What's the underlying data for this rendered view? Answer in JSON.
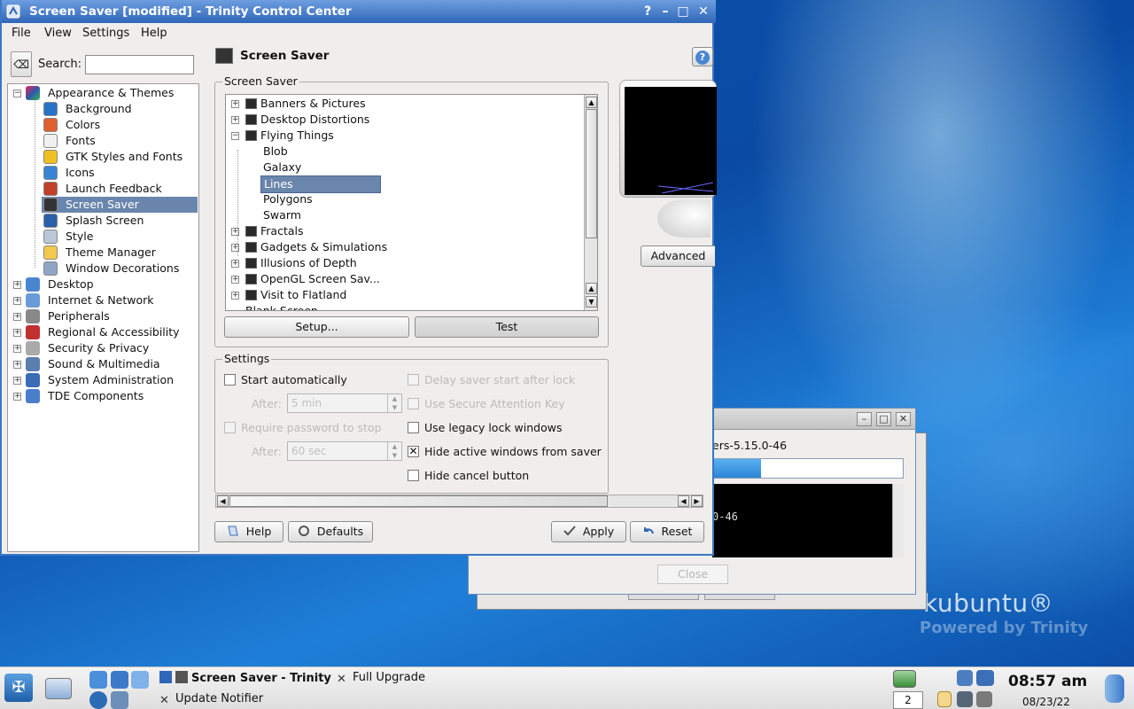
{
  "window": {
    "title": "Screen Saver [modified] - Trinity Control Center",
    "controls": {
      "help": "?",
      "minimize": "–",
      "maximize": "□",
      "close": "✕"
    }
  },
  "menu": [
    "File",
    "View",
    "Settings",
    "Help"
  ],
  "search": {
    "label": "Search:",
    "value": ""
  },
  "sidebar": {
    "appearance": {
      "label": "Appearance & Themes",
      "expander": "⊟"
    },
    "children": [
      {
        "label": "Background",
        "icon": "background-icon"
      },
      {
        "label": "Colors",
        "icon": "colors-icon"
      },
      {
        "label": "Fonts",
        "icon": "fonts-icon"
      },
      {
        "label": "GTK Styles and Fonts",
        "icon": "gtk-icon"
      },
      {
        "label": "Icons",
        "icon": "icons-icon"
      },
      {
        "label": "Launch Feedback",
        "icon": "launch-feedback-icon"
      },
      {
        "label": "Screen Saver",
        "icon": "screen-saver-icon",
        "selected": true
      },
      {
        "label": "Splash Screen",
        "icon": "splash-icon"
      },
      {
        "label": "Style",
        "icon": "style-icon"
      },
      {
        "label": "Theme Manager",
        "icon": "theme-manager-icon"
      },
      {
        "label": "Window Decorations",
        "icon": "window-decorations-icon"
      }
    ],
    "categories": [
      {
        "label": "Desktop",
        "icon": "desktop-icon"
      },
      {
        "label": "Internet & Network",
        "icon": "network-icon"
      },
      {
        "label": "Peripherals",
        "icon": "peripherals-icon"
      },
      {
        "label": "Regional & Accessibility",
        "icon": "regional-icon"
      },
      {
        "label": "Security & Privacy",
        "icon": "security-icon"
      },
      {
        "label": "Sound & Multimedia",
        "icon": "sound-icon"
      },
      {
        "label": "System Administration",
        "icon": "sysadmin-icon"
      },
      {
        "label": "TDE Components",
        "icon": "tde-icon"
      }
    ]
  },
  "panel": {
    "title": "Screen Saver",
    "saver_group": "Screen Saver",
    "list": [
      {
        "label": "Banners & Pictures",
        "type": "category"
      },
      {
        "label": "Desktop Distortions",
        "type": "category"
      },
      {
        "label": "Flying Things",
        "type": "category",
        "open": true
      },
      {
        "label": "Blob",
        "type": "child"
      },
      {
        "label": "Galaxy",
        "type": "child"
      },
      {
        "label": "Lines",
        "type": "child",
        "selected": true
      },
      {
        "label": "Polygons",
        "type": "child"
      },
      {
        "label": "Swarm",
        "type": "child"
      },
      {
        "label": "Fractals",
        "type": "category"
      },
      {
        "label": "Gadgets & Simulations",
        "type": "category"
      },
      {
        "label": "Illusions of Depth",
        "type": "category"
      },
      {
        "label": "OpenGL Screen Sav...",
        "type": "category"
      },
      {
        "label": "Visit to Flatland",
        "type": "category"
      },
      {
        "label": "Blank Screen",
        "type": "plain"
      }
    ],
    "setup_button": "Setup...",
    "test_button": "Test",
    "advanced_button": "Advanced",
    "settings_group": "Settings",
    "start_auto": "Start automatically",
    "after_label": "After:",
    "after_value": "5 min",
    "require_pw": "Require password to stop",
    "after2_label": "After:",
    "after2_value": "60 sec",
    "delay_lock": "Delay saver start after lock",
    "secure_key": "Use Secure Attention Key",
    "legacy_lock": "Use legacy lock windows",
    "hide_active": "Hide active windows from saver",
    "hide_active_checked": "✕",
    "hide_cancel": "Hide cancel button"
  },
  "bottom": {
    "help": "Help",
    "defaults": "Defaults",
    "apply": "Apply",
    "reset": "Reset"
  },
  "upgrade_window": {
    "package": "ers-5.15.0-46",
    "progress": 0.25,
    "term_line": "0-46",
    "close": "Close"
  },
  "wallpaper": {
    "brand": "kubuntu®",
    "sub": "Powered by Trinity"
  },
  "taskbar": {
    "tasks": [
      {
        "label": "Screen Saver - Trinity"
      },
      {
        "label": "Full Upgrade"
      },
      {
        "label": "Update Notifier"
      }
    ],
    "pager": "2",
    "time": "08:57 am",
    "date": "08/23/22"
  },
  "colors": {
    "selection": "#6b86ad",
    "titlebar": "#2f66b8"
  }
}
